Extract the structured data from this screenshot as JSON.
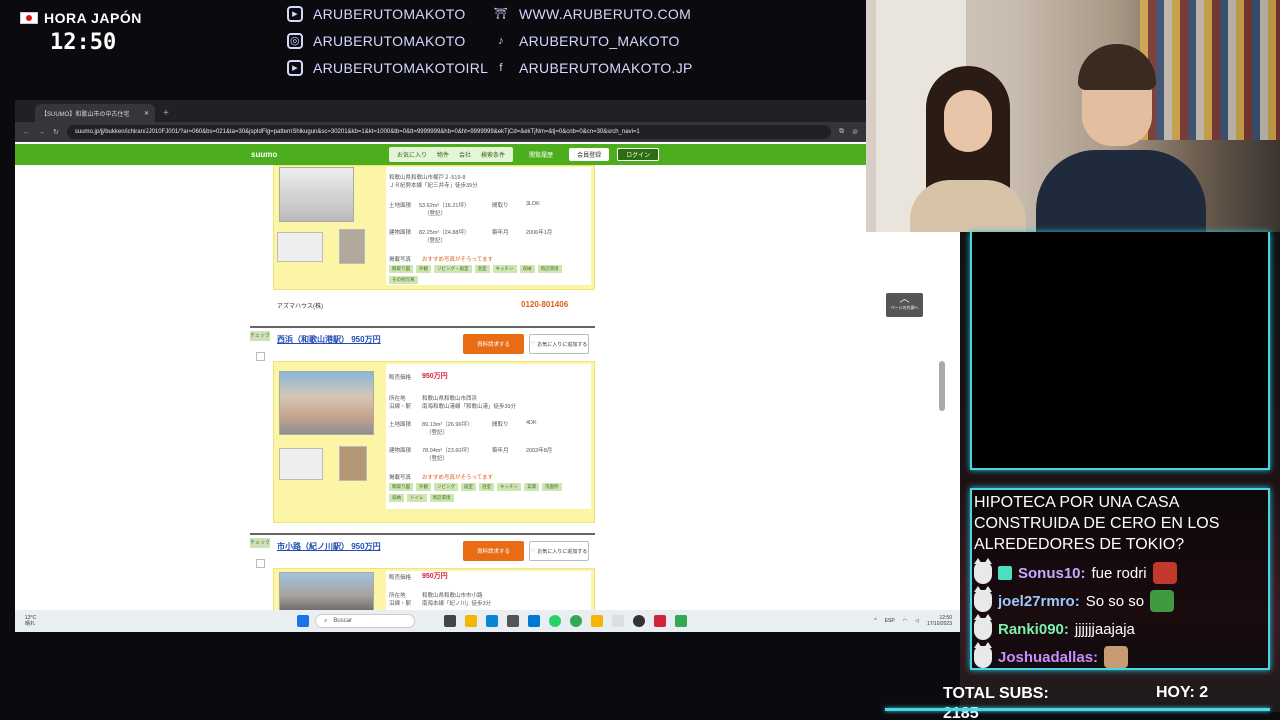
{
  "clock": {
    "label": "HORA JAPÓN",
    "time": "12:50"
  },
  "social": {
    "left": [
      {
        "icon": "youtube-icon",
        "text": "ARUBERUTOMAKOTO"
      },
      {
        "icon": "instagram-icon",
        "text": "ARUBERUTOMAKOTO"
      },
      {
        "icon": "youtube-icon",
        "text": "ARUBERUTOMAKOTOIRL"
      }
    ],
    "right": [
      {
        "icon": "torii-icon",
        "text": "WWW.ARUBERUTO.COM"
      },
      {
        "icon": "tiktok-icon",
        "text": "ARUBERUTO_MAKOTO"
      },
      {
        "icon": "facebook-icon",
        "text": "ARUBERUTOMAKOTO.JP"
      }
    ]
  },
  "browser": {
    "tab_title": "【SUUMO】和歌山市の中古住宅",
    "url": "suumo.jp/jj/bukken/ichiran/JJ010FJ001/?ar=060&bs=021&ta=30&jspIdFlg=patternShikugun&sc=30201&kb=1&kt=1000&tb=0&tt=9999999&hb=0&ht=9999999&ekTjCd=&ekTjNm=&tj=0&cnb=0&cn=30&srch_navi=1"
  },
  "suumo": {
    "logo": "suumo",
    "nav": [
      "お気に入り",
      "物件",
      "会社",
      "検索条件"
    ],
    "history": "閲覧履歴",
    "register": "会員登録",
    "login": "ログイン"
  },
  "listings": {
    "first": {
      "address": "和歌山県和歌山市梶戸２-519-8",
      "station": "ＪＲ紀勢本線「紀三井寺」徒歩39分",
      "land_label": "土地面積",
      "land": "53.62m²（16.21坪）",
      "land_note": "（登記）",
      "layout_label": "間取り",
      "layout": "3LDK",
      "building_label": "建物面積",
      "building": "82.25m²（24.88坪）",
      "building_note": "（登記）",
      "built_label": "築年月",
      "built": "2006年1月",
      "photo_label": "掲載写真",
      "highlight": "おすすめ写真がそろってます",
      "tags": [
        "間取り図",
        "外観",
        "リビング・居室",
        "浴室",
        "キッチン",
        "収納",
        "周辺環境",
        "その他写真"
      ],
      "agency": "アズマハウス(株)",
      "phone": "0120-801406"
    },
    "second": {
      "check": "チェック",
      "title": "西浜（和歌山港駅） 950万円",
      "request": "資料請求する",
      "fav": "お気に入りに追加する",
      "price_label": "販売価格",
      "price": "950万円",
      "address_label": "所在地",
      "station_label": "沿線・駅",
      "address": "和歌山県和歌山市西浜",
      "station": "南海和歌山港線「和歌山港」徒歩39分",
      "land_label": "土地面積",
      "land": "89.13m²（26.96坪）",
      "land_note": "（登記）",
      "layout_label": "間取り",
      "layout": "4DK",
      "building_label": "建物面積",
      "building": "78.04m²（23.60坪）",
      "building_note": "（登記）",
      "built_label": "築年月",
      "built": "2003年8月",
      "photo_label": "掲載写真",
      "highlight": "おすすめ写真がそろってます",
      "tags": [
        "間取り図",
        "外観",
        "リビング",
        "居室",
        "浴室",
        "キッチン",
        "玄関",
        "洗面所",
        "収納",
        "トイレ",
        "周辺環境"
      ]
    },
    "third": {
      "check": "チェック",
      "title": "市小路（紀ノ川駅） 950万円",
      "request": "資料請求する",
      "fav": "お気に入りに追加する",
      "price_label": "販売価格",
      "price": "950万円",
      "address_label": "所在地",
      "station_label": "沿線・駅",
      "address": "和歌山県和歌山市市小路",
      "station": "南海本線「紀ノ川」徒歩3分"
    }
  },
  "pagetop": "ページの先頭へ",
  "taskbar": {
    "weather_temp": "13°C",
    "weather_desc": "晴れ",
    "search": "Buscar",
    "lang": "ESP",
    "time": "12:50",
    "date": "17/10/2023"
  },
  "chat": {
    "title": "HIPOTECA POR UNA CASA CONSTRUIDA DE CERO EN LOS ALREDEDORES DE TOKIO?",
    "messages": [
      {
        "user": "Sonus10:",
        "text": "fue rodri",
        "color": "#c9a9ff"
      },
      {
        "user": "joel27rmro:",
        "text": "So so so",
        "color": "#9ec9ff"
      },
      {
        "user": "Ranki090:",
        "text": "jjjjjjaajaja",
        "color": "#7df0b0"
      },
      {
        "user": "Joshuadallas:",
        "text": "",
        "color": "#c98cff"
      }
    ]
  },
  "stats": {
    "subs_label": "TOTAL SUBS:",
    "subs_value": "2185",
    "today": "HOY: 2"
  },
  "colors": {
    "accent": "#48d7e6",
    "suumo_green": "#4cae1c",
    "price_red": "#d21e38"
  }
}
